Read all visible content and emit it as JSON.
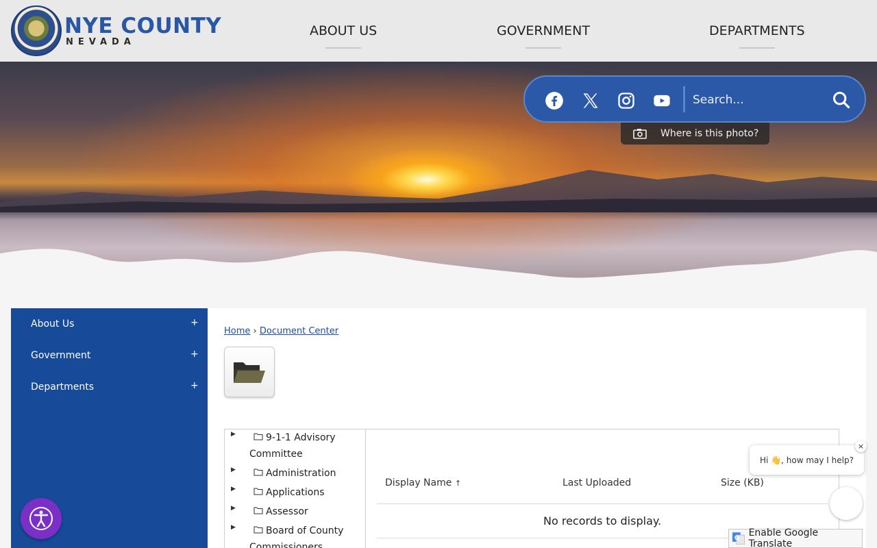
{
  "header": {
    "logo_title": "NYE COUNTY",
    "logo_subtitle": "NEVADA",
    "nav": [
      "ABOUT US",
      "GOVERNMENT",
      "DEPARTMENTS"
    ]
  },
  "social": {
    "icons": [
      "facebook-icon",
      "x-twitter-icon",
      "instagram-icon",
      "youtube-icon"
    ],
    "search_placeholder": "Search...",
    "photo_tab_label": "Where is this photo?"
  },
  "sidebar": {
    "items": [
      {
        "label": "About Us",
        "expand": "+"
      },
      {
        "label": "Government",
        "expand": "+"
      },
      {
        "label": "Departments",
        "expand": "+"
      }
    ]
  },
  "breadcrumb": {
    "home": "Home",
    "separator": "›",
    "current": "Document Center"
  },
  "tree": {
    "items": [
      {
        "line1": "9-1-1 Advisory",
        "line2": "Committee"
      },
      {
        "line1": "Administration",
        "line2": ""
      },
      {
        "line1": "Applications",
        "line2": ""
      },
      {
        "line1": "Assessor",
        "line2": ""
      },
      {
        "line1": "Board of County",
        "line2": "Commissioners"
      }
    ]
  },
  "grid": {
    "columns": [
      "Display Name",
      "Last Uploaded",
      "Size (KB)"
    ],
    "sort_indicator": "↑",
    "empty_message": "No records to display."
  },
  "chat": {
    "greeting": "Hi 👋, how may I help?",
    "close": "×"
  },
  "translate": {
    "label": "Enable Google Translate"
  },
  "colors": {
    "brand_blue": "#174a99",
    "social_bar": "#2b59a8",
    "accessibility_purple": "#7a2fc6"
  }
}
